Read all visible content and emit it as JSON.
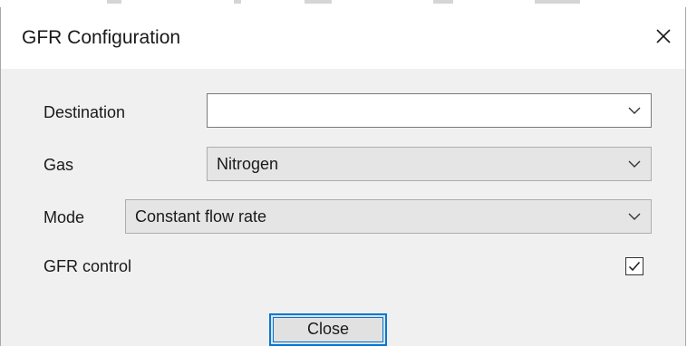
{
  "dialog": {
    "title": "GFR Configuration",
    "close_icon": "close-icon"
  },
  "form": {
    "destination": {
      "label": "Destination",
      "value": "",
      "icon": "chevron-down-icon"
    },
    "gas": {
      "label": "Gas",
      "value": "Nitrogen",
      "icon": "chevron-down-icon"
    },
    "mode": {
      "label": "Mode",
      "value": "Constant flow rate",
      "icon": "chevron-down-icon"
    },
    "gfr_control": {
      "label": "GFR control",
      "checked": true,
      "icon": "checkmark-icon"
    }
  },
  "buttons": {
    "close_label": "Close"
  },
  "colors": {
    "client_bg": "#f0f0f0",
    "focus_blue": "#0078d7",
    "combo_bg": "#e5e5e5"
  }
}
